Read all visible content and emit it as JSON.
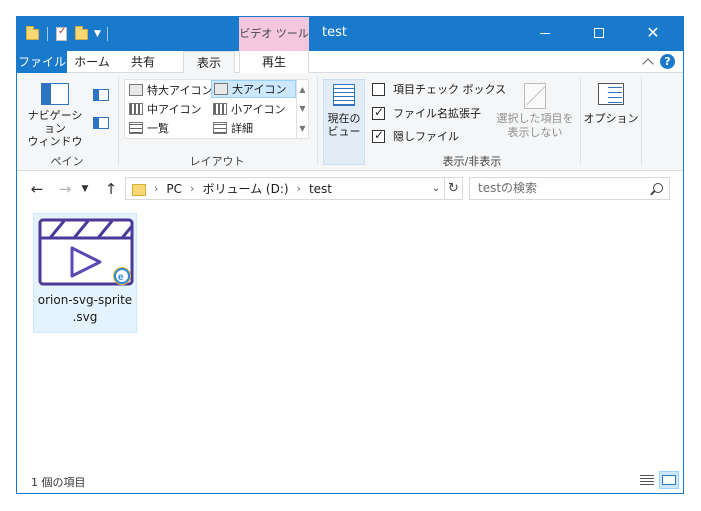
{
  "window": {
    "title": "test",
    "contextual_tab_group": "ビデオ ツール"
  },
  "ribbon_tabs": {
    "file": "ファイル",
    "home": "ホーム",
    "share": "共有",
    "view": "表示",
    "play": "再生"
  },
  "ribbon": {
    "panes": {
      "nav_pane_label": "ナビゲーション\nウィンドウ",
      "group_label": "ペイン"
    },
    "layout": {
      "items": [
        "特大アイコン",
        "大アイコン",
        "中アイコン",
        "小アイコン",
        "一覧",
        "詳細"
      ],
      "selected": "大アイコン",
      "group_label": "レイアウト"
    },
    "current_view_label": "現在の\nビュー",
    "show_hide": {
      "item_checkboxes": {
        "label": "項目チェック ボックス",
        "checked": false
      },
      "file_extensions": {
        "label": "ファイル名拡張子",
        "checked": true
      },
      "hidden_items": {
        "label": "隠しファイル",
        "checked": true
      },
      "hide_selected_label": "選択した項目を\n表示しない",
      "group_label": "表示/非表示"
    },
    "options_label": "オプション"
  },
  "address": {
    "crumbs": [
      "PC",
      "ボリューム (D:)",
      "test"
    ],
    "search_placeholder": "testの検索"
  },
  "files": [
    {
      "name": "orion-svg-sprite.svg",
      "name_line1": "orion-svg-sprite",
      "name_line2": ".svg",
      "icon": "video-clapperboard-thumbnail"
    }
  ],
  "status": {
    "item_count": "1 個の項目"
  },
  "colors": {
    "accent": "#1979ca",
    "contextual_tab": "#f4c7de",
    "selection": "#cce8ff",
    "thumbnail_stroke": "#4a3a9a"
  }
}
